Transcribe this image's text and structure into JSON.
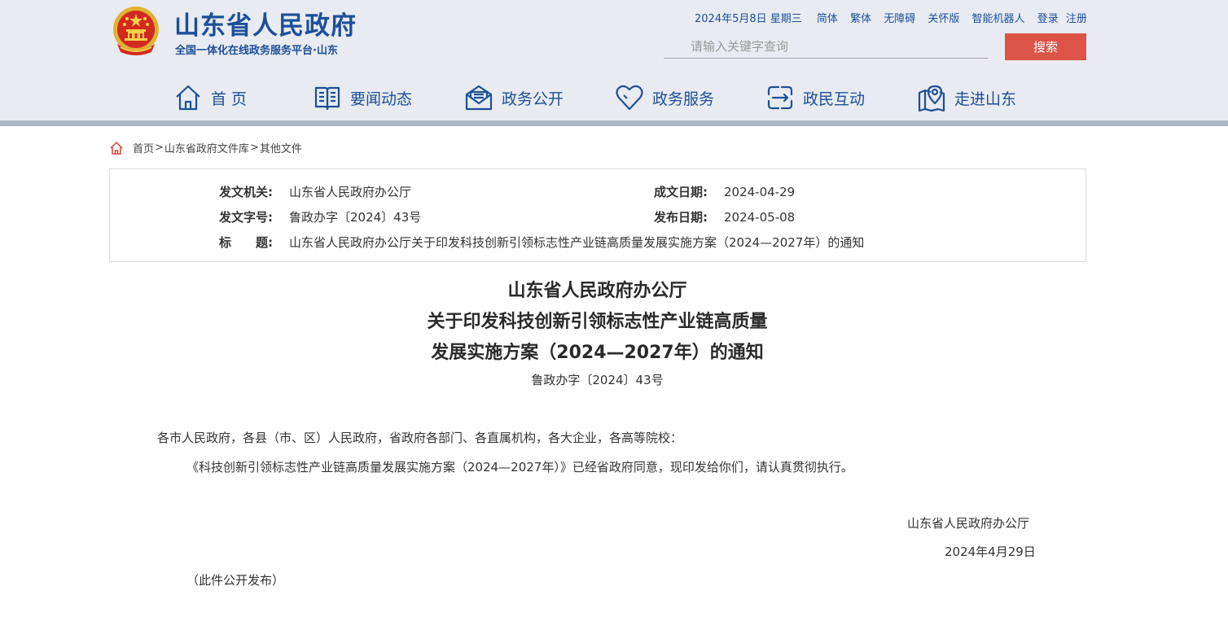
{
  "site": {
    "title": "山东省人民政府",
    "subtitle": "全国一体化在线政务服务平台·山东"
  },
  "topbar": {
    "date": "2024年5月8日 星期三",
    "links": [
      "简体",
      "繁体",
      "无障碍",
      "关怀版",
      "智能机器人",
      "登录",
      "注册"
    ]
  },
  "search": {
    "placeholder": "请输入关键字查询",
    "button": "搜索"
  },
  "nav": {
    "items": [
      {
        "label": "首 页",
        "icon": "home-icon"
      },
      {
        "label": "要闻动态",
        "icon": "book-icon"
      },
      {
        "label": "政务公开",
        "icon": "mail-icon"
      },
      {
        "label": "政务服务",
        "icon": "heart-icon"
      },
      {
        "label": "政民互动",
        "icon": "exchange-icon"
      },
      {
        "label": "走进山东",
        "icon": "map-pin-icon"
      }
    ]
  },
  "breadcrumb": {
    "items": [
      "首页",
      "山东省政府文件库",
      "其他文件"
    ],
    "separator": ">"
  },
  "info": {
    "issuer_label": "发文机关:",
    "issuer": "山东省人民政府办公厅",
    "doc_no_label": "发文字号:",
    "doc_no": "鲁政办字〔2024〕43号",
    "subject_label": "标　　题:",
    "subject": "山东省人民政府办公厅关于印发科技创新引领标志性产业链高质量发展实施方案（2024—2027年）的通知",
    "created_label": "成文日期:",
    "created": "2024-04-29",
    "published_label": "发布日期:",
    "published": "2024-05-08"
  },
  "document": {
    "title_lines": [
      "山东省人民政府办公厅",
      "关于印发科技创新引领标志性产业链高质量",
      "发展实施方案（2024—2027年）的通知"
    ],
    "number": "鲁政办字〔2024〕43号",
    "addressees": "各市人民政府，各县（市、区）人民政府，省政府各部门、各直属机构，各大企业，各高等院校：",
    "body": "《科技创新引领标志性产业链高质量发展实施方案（2024—2027年）》已经省政府同意，现印发给你们，请认真贯彻执行。",
    "signature": "山东省人民政府办公厅",
    "date": "2024年4月29日",
    "note": "（此件公开发布）"
  },
  "colors": {
    "brand_blue": "#1d4f9a",
    "search_button": "#dc5448",
    "header_bg": "#e8ebf1"
  }
}
